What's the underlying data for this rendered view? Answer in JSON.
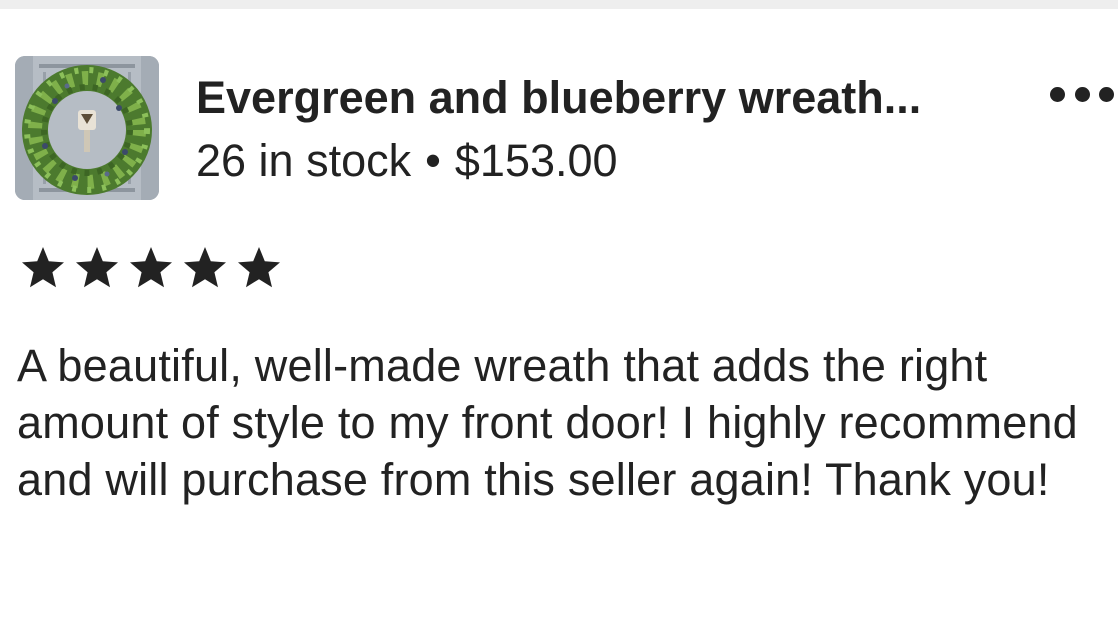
{
  "listing": {
    "title": "Evergreen and blueberry wreath...",
    "stock": "26 in stock",
    "separator": "•",
    "price": "$153.00",
    "thumbnail_icon": "wreath-photo"
  },
  "menu": {
    "icon": "more-horizontal-icon"
  },
  "review": {
    "rating": 5,
    "rating_max": 5,
    "text": "A beautiful, well-made wreath that adds the right amount of style to my front door! I highly recommend and will purchase from this seller again! Thank you!"
  },
  "colors": {
    "text": "#222222",
    "background": "#ffffff",
    "top_strip": "#eeeeee",
    "star": "#222222"
  }
}
